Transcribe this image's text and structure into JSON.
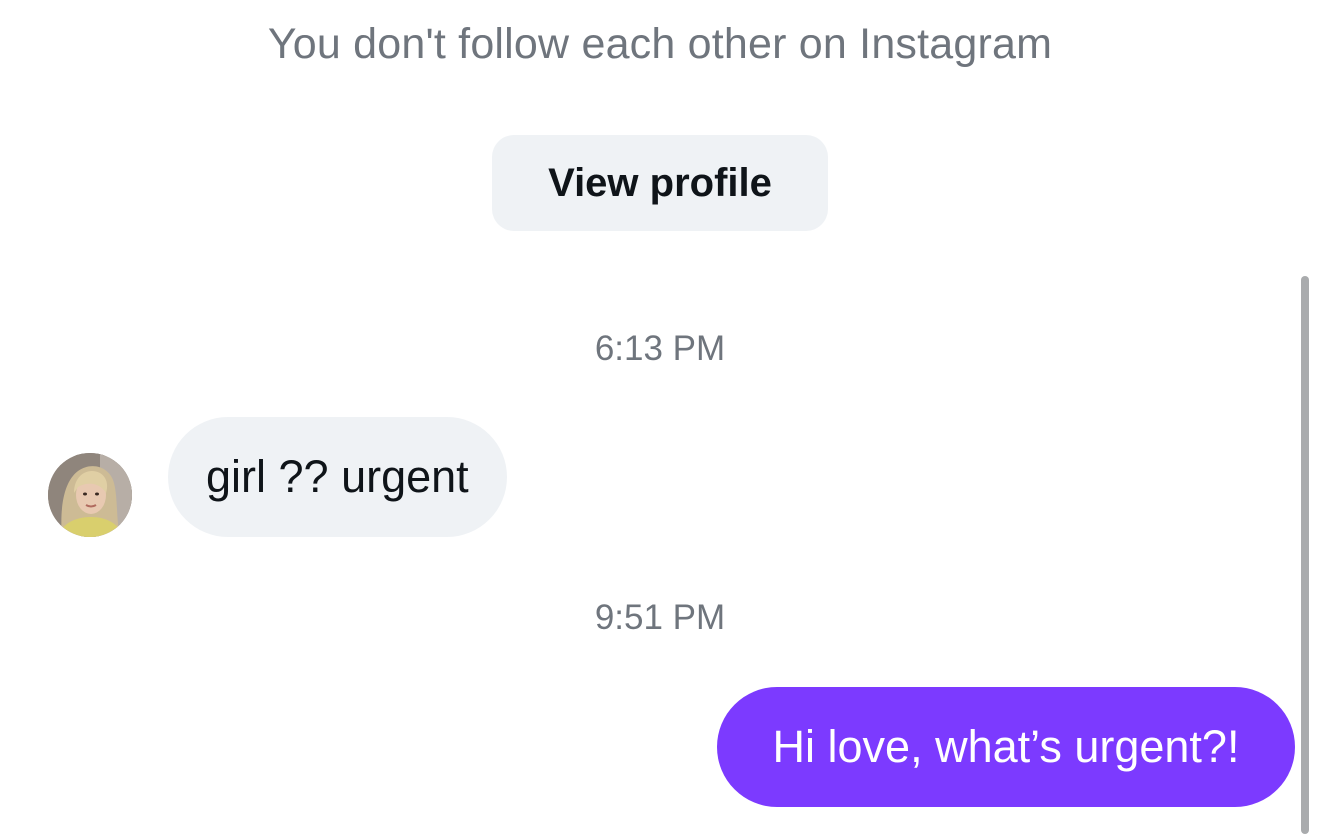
{
  "header": {
    "follow_note": "You don't follow each other on Instagram",
    "view_profile_label": "View profile"
  },
  "messages": [
    {
      "timestamp": "6:13 PM",
      "direction": "incoming",
      "text": "girl ?? urgent",
      "avatar": "user-avatar"
    },
    {
      "timestamp": "9:51 PM",
      "direction": "outgoing",
      "text": "Hi love, what’s urgent?!"
    }
  ],
  "colors": {
    "incoming_bubble": "#eff2f5",
    "outgoing_bubble": "#7c3aff",
    "secondary_text": "#6f757d",
    "primary_text": "#0f1419",
    "scrollbar": "#a9abad"
  }
}
